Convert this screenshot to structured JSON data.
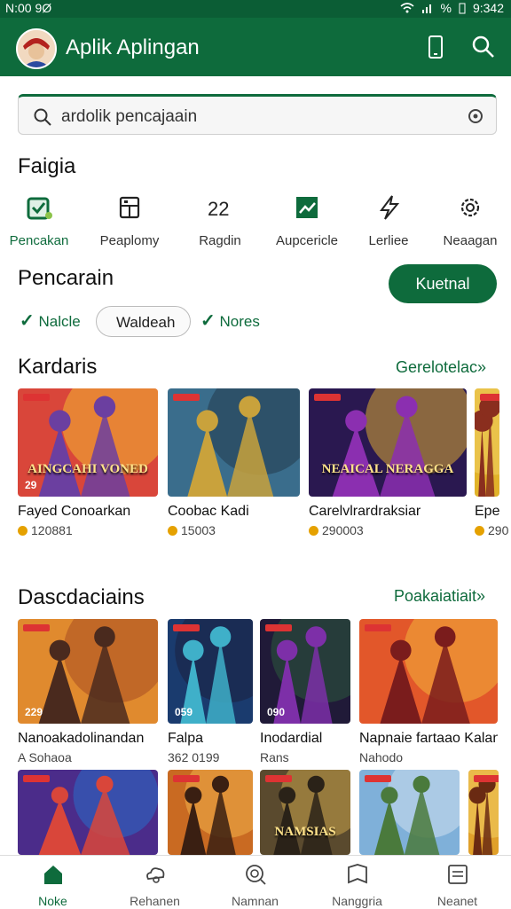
{
  "status": {
    "time": "N:00 9Ø",
    "battery": "%",
    "clock_right": "9:342"
  },
  "appbar": {
    "title": "Aplik Aplingan",
    "accent": "#0e6b3c"
  },
  "search": {
    "query": "ardolik pencajaain"
  },
  "category_section": {
    "heading": "Faigia",
    "items": [
      {
        "label": "Pencakan",
        "icon": "grid-check-icon"
      },
      {
        "label": "Peaplomy",
        "icon": "puzzle-icon"
      },
      {
        "label": "Ragdin",
        "icon": "22-icon"
      },
      {
        "label": "Aupcericle",
        "icon": "chart-icon"
      },
      {
        "label": "Lerliee",
        "icon": "lightning-icon"
      },
      {
        "label": "Neaagan",
        "icon": "gear-icon"
      }
    ]
  },
  "filter_section": {
    "heading": "Pencarain",
    "button": "Kuetnal",
    "chips": [
      {
        "label": "Nalcle",
        "checked": true
      },
      {
        "label": "Waldeah",
        "checked": false
      },
      {
        "label": "Nores",
        "checked": true
      }
    ]
  },
  "section1": {
    "heading": "Kardaris",
    "see_all": "Gerelotelac»",
    "cards": [
      {
        "title": "Fayed Conoarkan",
        "sub": "120881",
        "tag": "29",
        "thumb_text": "AINGCAHI VONED",
        "colors": [
          "#d9463a",
          "#6b3fa0",
          "#f2b632"
        ]
      },
      {
        "title": "Coobac Kadi",
        "sub": "15003",
        "tag": "",
        "thumb_text": "",
        "colors": [
          "#3a6d8c",
          "#c9a23c",
          "#233a4d"
        ]
      },
      {
        "title": "Carelvlrardraksiar",
        "sub": "290003",
        "tag": "",
        "thumb_text": "NEAICAL NERAGGA",
        "colors": [
          "#2a1850",
          "#8b2fb0",
          "#d9a933"
        ]
      },
      {
        "title": "Epe",
        "sub": "290",
        "tag": "",
        "thumb_text": "",
        "colors": [
          "#e1b32a",
          "#8a2e1e",
          "#f2d064"
        ]
      }
    ]
  },
  "section2": {
    "heading": "Dascdaciains",
    "see_all": "Poakaiatiait»",
    "cards": [
      {
        "title": "Nanoakadolinandan",
        "sub": "A Sohaoa",
        "tag": "229",
        "colors": [
          "#e08a2e",
          "#4a2a1e",
          "#a84c22"
        ]
      },
      {
        "title": "Falpa",
        "sub": "362 0199",
        "tag": "059",
        "colors": [
          "#1a3b6e",
          "#3fb0c9",
          "#1c2140"
        ]
      },
      {
        "title": "Inodardial",
        "sub": "Rans",
        "tag": "090",
        "colors": [
          "#201a38",
          "#7d2fa8",
          "#2c5a3c"
        ]
      },
      {
        "title": "Napnaie fartaao Kalan",
        "sub": "Nahodo",
        "tag": "",
        "colors": [
          "#e2572a",
          "#7a1c1c",
          "#f2b33a"
        ]
      }
    ],
    "row2": [
      {
        "thumb_text": "",
        "colors": [
          "#4b2c8a",
          "#d9463a",
          "#2a6ec9"
        ]
      },
      {
        "thumb_text": "",
        "colors": [
          "#c96a22",
          "#3a1f12",
          "#f0b04a"
        ]
      },
      {
        "thumb_text": "NAMSIAS",
        "colors": [
          "#5a4a2e",
          "#2a2218",
          "#c9a24a"
        ]
      },
      {
        "thumb_text": "",
        "colors": [
          "#7fb0d9",
          "#4a7a3c",
          "#cfe0ee"
        ]
      },
      {
        "thumb_text": "",
        "colors": [
          "#e0a02a",
          "#6a2a12",
          "#f2d064"
        ]
      }
    ]
  },
  "bottom_nav": [
    {
      "label": "Noke",
      "icon": "home-icon",
      "active": true
    },
    {
      "label": "Rehanen",
      "icon": "cloud-person-icon",
      "active": false
    },
    {
      "label": "Namnan",
      "icon": "search-circle-icon",
      "active": false
    },
    {
      "label": "Nanggria",
      "icon": "shield-icon",
      "active": false
    },
    {
      "label": "Neanet",
      "icon": "list-icon",
      "active": false
    }
  ]
}
